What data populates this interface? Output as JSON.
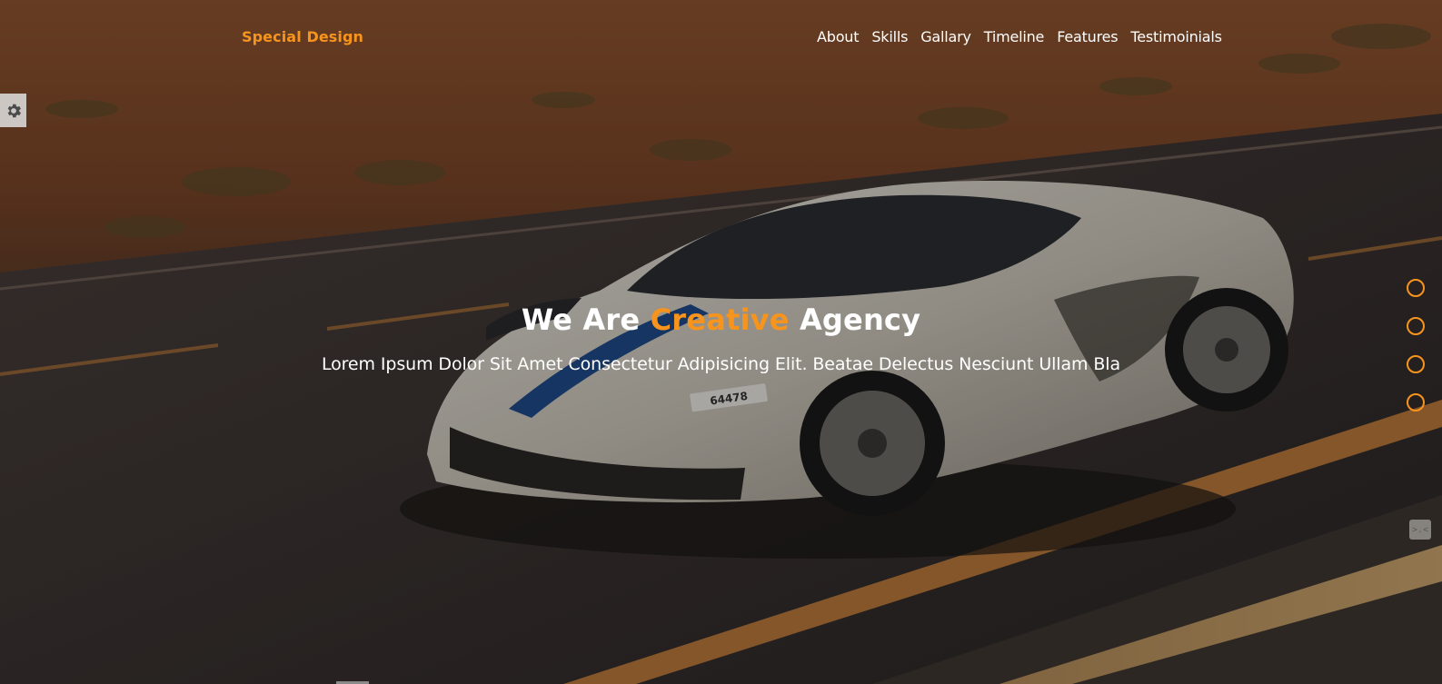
{
  "header": {
    "logo": "Special Design",
    "nav": [
      "About",
      "Skills",
      "Gallary",
      "Timeline",
      "Features",
      "Testimoinials"
    ]
  },
  "hero": {
    "title_before": "We Are ",
    "title_accent": "Creative",
    "title_after": " Agency",
    "subtitle": "Lorem Ipsum Dolor Sit Amet Consectetur Adipisicing Elit. Beatae Delectus Nesciunt Ullam Bla",
    "license_plate": "64478"
  },
  "bullets_count": 4,
  "corner_widget_text": ">.<",
  "colors": {
    "accent": "#f7941d",
    "text": "#ffffff"
  },
  "icons": {
    "settings": "gear-icon",
    "bullet": "circle-outline-icon"
  }
}
